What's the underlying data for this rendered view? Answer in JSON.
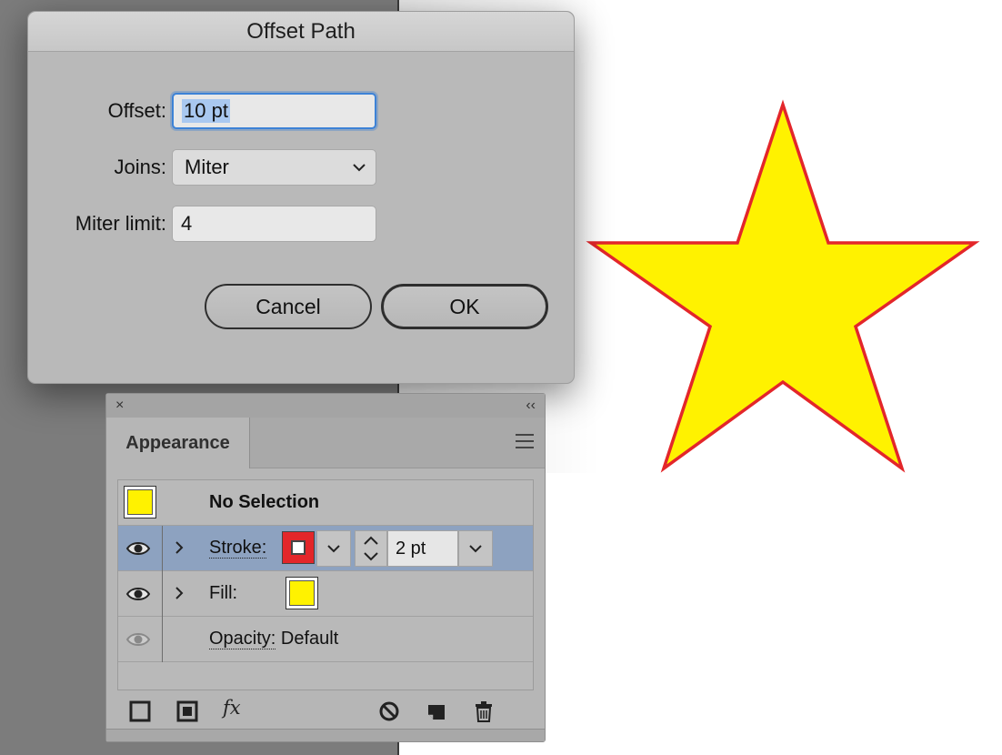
{
  "dialog": {
    "title": "Offset Path",
    "offset_label": "Offset:",
    "offset_value": "10 pt",
    "joins_label": "Joins:",
    "joins_value": "Miter",
    "miter_label": "Miter limit:",
    "miter_value": "4",
    "cancel_label": "Cancel",
    "ok_label": "OK"
  },
  "panel": {
    "close_glyph": "×",
    "collapse_glyph": "‹‹",
    "tab_label": "Appearance",
    "selection_label": "No Selection",
    "stroke_label": "Stroke:",
    "stroke_weight": "2 pt",
    "fill_label": "Fill:",
    "opacity_label": "Opacity:",
    "opacity_value": "Default",
    "fx_label": "fx"
  },
  "colors": {
    "star_fill": "#fff200",
    "star_stroke": "#e3262a",
    "selected_row": "#8da2c0",
    "focus_ring": "#3d82d6"
  },
  "icons": [
    "close-icon",
    "collapse-icon",
    "panel-menu-icon",
    "eye-icon",
    "chevron-right-icon",
    "chevron-down-icon",
    "stepper-icon",
    "add-stroke-icon",
    "add-fill-icon",
    "fx-icon",
    "clear-appearance-icon",
    "duplicate-item-icon",
    "trash-icon"
  ]
}
